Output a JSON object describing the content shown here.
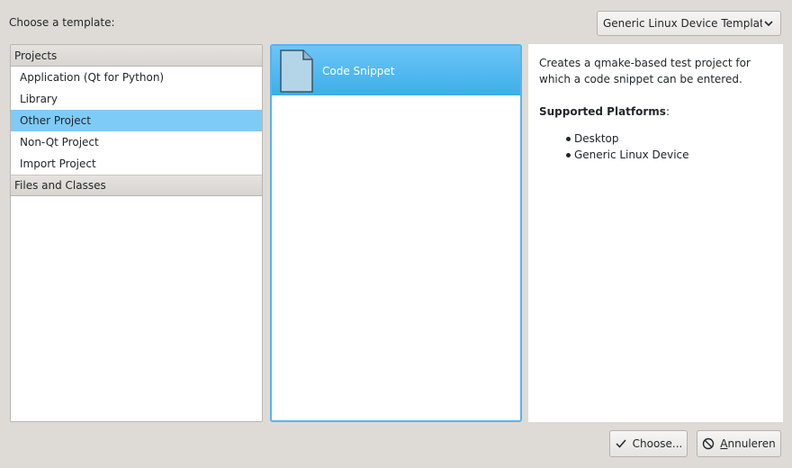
{
  "header": {
    "choose_label": "Choose a template:",
    "template_set": "Generic Linux Device Templates"
  },
  "categories": [
    {
      "header": "Projects",
      "items": [
        {
          "label": "Application (Qt for Python)",
          "selected": false
        },
        {
          "label": "Library",
          "selected": false
        },
        {
          "label": "Other Project",
          "selected": true
        },
        {
          "label": "Non-Qt Project",
          "selected": false
        },
        {
          "label": "Import Project",
          "selected": false
        }
      ]
    },
    {
      "header": "Files and Classes",
      "items": []
    }
  ],
  "templates": [
    {
      "name": "Code Snippet",
      "icon": "document-icon",
      "selected": true
    }
  ],
  "description": {
    "text": "Creates a qmake-based test project for which a code snippet can be entered.",
    "platforms_heading": "Supported Platforms",
    "platforms_suffix": ":",
    "platforms": [
      "Desktop",
      "Generic Linux Device"
    ]
  },
  "buttons": {
    "choose": "Choose...",
    "cancel_mnemonic": "A",
    "cancel_rest": "nnuleren"
  },
  "colors": {
    "selection": "#7fcbf7",
    "accent": "#3daee9",
    "window_bg": "#dedbd7"
  }
}
